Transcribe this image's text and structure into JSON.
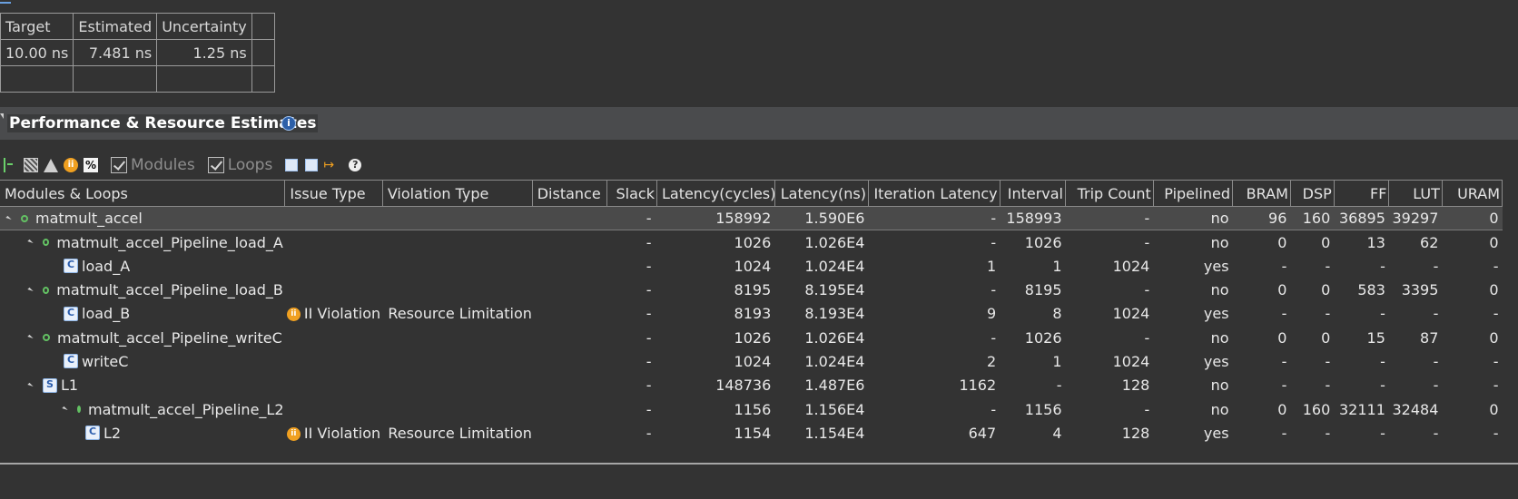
{
  "timing": {
    "headers": [
      "Target",
      "Estimated",
      "Uncertainty",
      ""
    ],
    "row": [
      "10.00 ns",
      "7.481 ns",
      "1.25 ns",
      ""
    ]
  },
  "section": {
    "title": "Performance & Resource Estimates",
    "info_icon": "info-icon"
  },
  "toolbar": {
    "modules_label": "Modules",
    "loops_label": "Loops",
    "modules_checked": true,
    "loops_checked": true,
    "icons": [
      "tree-icon",
      "grid-icon",
      "warning-icon",
      "ii-icon",
      "percent-icon",
      "expand-all-icon",
      "collapse-all-icon",
      "arrow-icon",
      "help-icon"
    ]
  },
  "grid": {
    "columns": [
      "Modules & Loops",
      "Issue Type",
      "Violation Type",
      "Distance",
      "Slack",
      "Latency(cycles)",
      "Latency(ns)",
      "Iteration Latency",
      "Interval",
      "Trip Count",
      "Pipelined",
      "BRAM",
      "DSP",
      "FF",
      "LUT",
      "URAM"
    ],
    "rows": [
      {
        "name": "matmult_accel",
        "kind": "module",
        "depth": 0,
        "issue": "",
        "violation": "",
        "distance": "",
        "slack": "-",
        "lat_cycles": "158992",
        "lat_ns": "1.590E6",
        "iter_lat": "-",
        "interval": "158993",
        "interval_red": false,
        "trip": "-",
        "pipelined": "no",
        "bram": "96",
        "dsp": "160",
        "ff": "36895",
        "lut": "39297",
        "uram": "0"
      },
      {
        "name": "matmult_accel_Pipeline_load_A",
        "kind": "module",
        "depth": 1,
        "issue": "",
        "violation": "",
        "distance": "",
        "slack": "-",
        "lat_cycles": "1026",
        "lat_ns": "1.026E4",
        "iter_lat": "-",
        "interval": "1026",
        "interval_red": false,
        "trip": "-",
        "pipelined": "no",
        "bram": "0",
        "dsp": "0",
        "ff": "13",
        "lut": "62",
        "uram": "0"
      },
      {
        "name": "load_A",
        "kind": "loop",
        "depth": 2,
        "issue": "",
        "violation": "",
        "distance": "",
        "slack": "-",
        "lat_cycles": "1024",
        "lat_ns": "1.024E4",
        "iter_lat": "1",
        "interval": "1",
        "interval_red": false,
        "trip": "1024",
        "pipelined": "yes",
        "bram": "-",
        "dsp": "-",
        "ff": "-",
        "lut": "-",
        "uram": "-"
      },
      {
        "name": "matmult_accel_Pipeline_load_B",
        "kind": "module",
        "depth": 1,
        "issue": "",
        "violation": "",
        "distance": "",
        "slack": "-",
        "lat_cycles": "8195",
        "lat_ns": "8.195E4",
        "iter_lat": "-",
        "interval": "8195",
        "interval_red": false,
        "trip": "-",
        "pipelined": "no",
        "bram": "0",
        "dsp": "0",
        "ff": "583",
        "lut": "3395",
        "uram": "0"
      },
      {
        "name": "load_B",
        "kind": "loop",
        "depth": 2,
        "issue": "II Violation",
        "violation": "Resource Limitation",
        "distance": "",
        "slack": "-",
        "lat_cycles": "8193",
        "lat_ns": "8.193E4",
        "iter_lat": "9",
        "interval": "8",
        "interval_red": true,
        "trip": "1024",
        "pipelined": "yes",
        "bram": "-",
        "dsp": "-",
        "ff": "-",
        "lut": "-",
        "uram": "-"
      },
      {
        "name": "matmult_accel_Pipeline_writeC",
        "kind": "module",
        "depth": 1,
        "issue": "",
        "violation": "",
        "distance": "",
        "slack": "-",
        "lat_cycles": "1026",
        "lat_ns": "1.026E4",
        "iter_lat": "-",
        "interval": "1026",
        "interval_red": false,
        "trip": "-",
        "pipelined": "no",
        "bram": "0",
        "dsp": "0",
        "ff": "15",
        "lut": "87",
        "uram": "0"
      },
      {
        "name": "writeC",
        "kind": "loop",
        "depth": 2,
        "issue": "",
        "violation": "",
        "distance": "",
        "slack": "-",
        "lat_cycles": "1024",
        "lat_ns": "1.024E4",
        "iter_lat": "2",
        "interval": "1",
        "interval_red": false,
        "trip": "1024",
        "pipelined": "yes",
        "bram": "-",
        "dsp": "-",
        "ff": "-",
        "lut": "-",
        "uram": "-"
      },
      {
        "name": "L1",
        "kind": "outer-loop",
        "depth": 1,
        "issue": "",
        "violation": "",
        "distance": "",
        "slack": "-",
        "lat_cycles": "148736",
        "lat_ns": "1.487E6",
        "iter_lat": "1162",
        "interval": "-",
        "interval_red": false,
        "trip": "128",
        "pipelined": "no",
        "bram": "-",
        "dsp": "-",
        "ff": "-",
        "lut": "-",
        "uram": "-"
      },
      {
        "name": "matmult_accel_Pipeline_L2",
        "kind": "module",
        "depth": 2,
        "issue": "",
        "violation": "",
        "distance": "",
        "slack": "-",
        "lat_cycles": "1156",
        "lat_ns": "1.156E4",
        "iter_lat": "-",
        "interval": "1156",
        "interval_red": false,
        "trip": "-",
        "pipelined": "no",
        "bram": "0",
        "dsp": "160",
        "ff": "32111",
        "lut": "32484",
        "uram": "0"
      },
      {
        "name": "L2",
        "kind": "loop",
        "depth": 3,
        "issue": "II Violation",
        "violation": "Resource Limitation",
        "distance": "",
        "slack": "-",
        "lat_cycles": "1154",
        "lat_ns": "1.154E4",
        "iter_lat": "647",
        "interval": "4",
        "interval_red": true,
        "trip": "128",
        "pipelined": "yes",
        "bram": "-",
        "dsp": "-",
        "ff": "-",
        "lut": "-",
        "uram": "-"
      }
    ]
  },
  "colors": {
    "background": "#333333",
    "section_bar": "#4a4b4d",
    "violation_red": "#ff3b3b",
    "ii_orange": "#f0a020",
    "module_dot_green": "#63c163"
  }
}
